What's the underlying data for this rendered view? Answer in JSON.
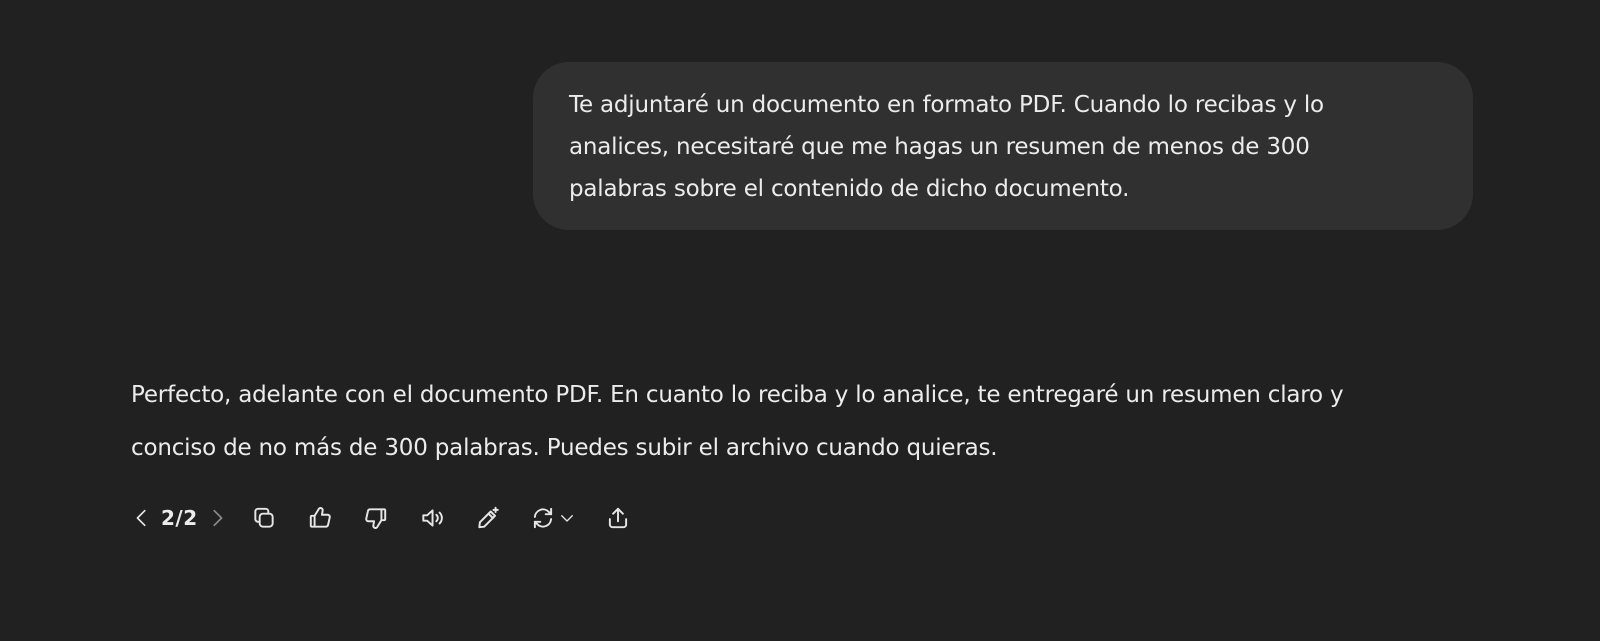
{
  "user_message": {
    "lines": [
      "Te adjuntaré un documento en formato PDF. Cuando lo recibas y lo",
      "analices, necesitaré que me hagas un resumen de menos de 300",
      "palabras sobre el contenido de dicho documento."
    ]
  },
  "assistant_message": {
    "lines": [
      "Perfecto, adelante con el documento PDF. En cuanto lo reciba y lo analice, te entregaré un resumen claro y",
      "conciso de no más de 300 palabras. Puedes subir el archivo cuando quieras."
    ]
  },
  "actions": {
    "response_counter": "2/2",
    "icons": [
      "chevron-left-icon",
      "chevron-right-icon",
      "copy-icon",
      "thumbs-up-icon",
      "thumbs-down-icon",
      "speaker-icon",
      "edit-sparkle-icon",
      "regenerate-icon",
      "chevron-down-icon",
      "share-icon"
    ]
  },
  "colors": {
    "background": "#212121",
    "user_bubble": "#303030",
    "text": "#ececec"
  }
}
